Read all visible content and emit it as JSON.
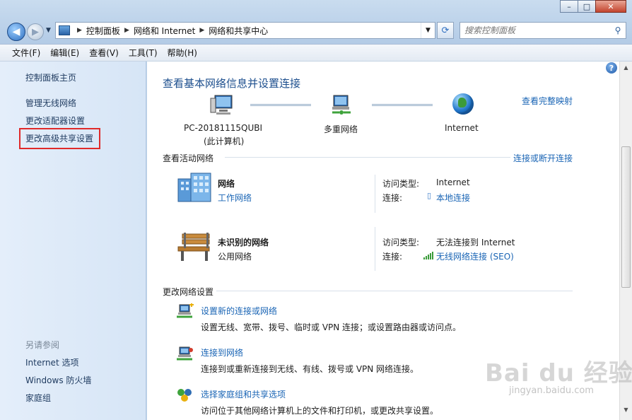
{
  "window": {
    "minimize": "–",
    "maximize": "□",
    "close": "✕"
  },
  "address_bar": {
    "crumbs": [
      "控制面板",
      "网络和 Internet",
      "网络和共享中心"
    ]
  },
  "search": {
    "placeholder": "搜索控制面板"
  },
  "menu": [
    "文件(F)",
    "编辑(E)",
    "查看(V)",
    "工具(T)",
    "帮助(H)"
  ],
  "sidebar": {
    "home": "控制面板主页",
    "items": [
      "管理无线网络",
      "更改适配器设置",
      "更改高级共享设置"
    ],
    "see_also_title": "另请参阅",
    "see_also": [
      "Internet 选项",
      "Windows 防火墙",
      "家庭组"
    ]
  },
  "main": {
    "help": "?",
    "title": "查看基本网络信息并设置连接",
    "full_map": "查看完整映射",
    "map": {
      "computer_name": "PC-20181115QUBI",
      "computer_sub": "(此计算机)",
      "middle": "多重网络",
      "internet": "Internet"
    },
    "active_title": "查看活动网络",
    "connect_link": "连接或断开连接",
    "networks": [
      {
        "name": "网络",
        "type": "工作网络",
        "access_key": "访问类型:",
        "access_val": "Internet",
        "conn_key": "连接:",
        "conn_val": "本地连接"
      },
      {
        "name": "未识别的网络",
        "type": "公用网络",
        "access_key": "访问类型:",
        "access_val": "无法连接到 Internet",
        "conn_key": "连接:",
        "conn_val": "无线网络连接 (SEO)"
      }
    ],
    "change_title": "更改网络设置",
    "tasks": [
      {
        "link": "设置新的连接或网络",
        "desc": "设置无线、宽带、拨号、临时或 VPN 连接；或设置路由器或访问点。"
      },
      {
        "link": "连接到网络",
        "desc": "连接到或重新连接到无线、有线、拨号或 VPN 网络连接。"
      },
      {
        "link": "选择家庭组和共享选项",
        "desc": "访问位于其他网络计算机上的文件和打印机，或更改共享设置。"
      }
    ]
  },
  "watermark": {
    "brand": "Bai du 经验",
    "url": "jingyan.baidu.com"
  },
  "colors": {
    "link": "#1a65b5",
    "title": "#1d4f8e",
    "highlight": "#e02a2a"
  }
}
